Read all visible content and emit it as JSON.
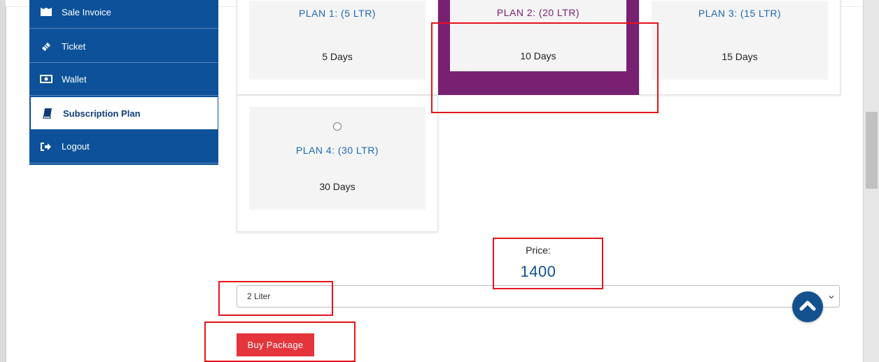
{
  "sidebar": {
    "items": [
      {
        "label": "Sale Invoice",
        "icon": "invoice-icon"
      },
      {
        "label": "Ticket",
        "icon": "ticket-icon"
      },
      {
        "label": "Wallet",
        "icon": "wallet-icon"
      },
      {
        "label": "Subscription Plan",
        "icon": "book-icon",
        "active": true
      },
      {
        "label": "Logout",
        "icon": "logout-icon"
      }
    ]
  },
  "plans": [
    {
      "title": "PLAN 1: (5 LTR)",
      "days": "5 Days"
    },
    {
      "title": "PLAN 2: (20 LTR)",
      "days": "10 Days",
      "selected": true
    },
    {
      "title": "PLAN 3: (15 LTR)",
      "days": "15 Days"
    },
    {
      "title": "PLAN 4: (30 LTR)",
      "days": "30 Days"
    }
  ],
  "price": {
    "label": "Price:",
    "value": "1400"
  },
  "quantity_select": {
    "selected": "2 Liter"
  },
  "buy_button": {
    "label": "Buy Package"
  },
  "colors": {
    "sidebar_bg": "#0c5199",
    "selected_plan": "#782173",
    "plan_title": "#1d67b0",
    "buy_button": "#e4353c",
    "highlight": "#e4141b"
  }
}
